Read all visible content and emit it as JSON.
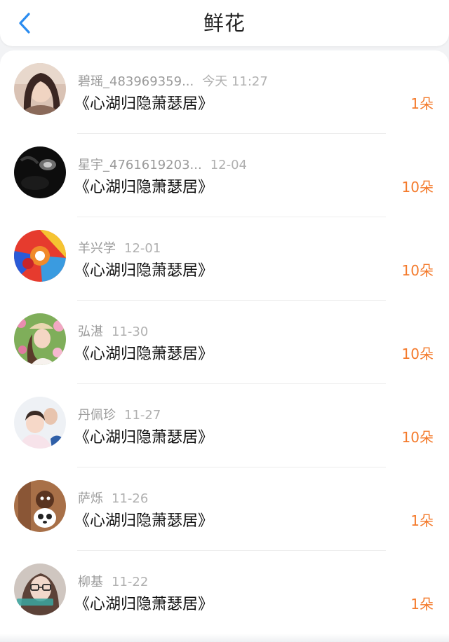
{
  "header": {
    "title": "鲜花",
    "back_icon": "chevron-left-icon",
    "accent_color": "#2b8cf0"
  },
  "list": {
    "count_color": "#f47a2b",
    "items": [
      {
        "name": "碧瑶_483969359...",
        "time": "今天 11:27",
        "book": "《心湖归隐萧瑟居》",
        "count": "1朵",
        "avatar": "avatar-woman-photo"
      },
      {
        "name": "星宇_4761619203...",
        "time": "12-04",
        "book": "《心湖归隐萧瑟居》",
        "count": "10朵",
        "avatar": "avatar-dark-photo"
      },
      {
        "name": "羊兴学",
        "time": "12-01",
        "book": "《心湖归隐萧瑟居》",
        "count": "10朵",
        "avatar": "avatar-colorful-swirl"
      },
      {
        "name": "弘湛",
        "time": "11-30",
        "book": "《心湖归隐萧瑟居》",
        "count": "10朵",
        "avatar": "avatar-woman-flowers"
      },
      {
        "name": "丹佩珍",
        "time": "11-27",
        "book": "《心湖归隐萧瑟居》",
        "count": "10朵",
        "avatar": "avatar-child-photo"
      },
      {
        "name": "萨烁",
        "time": "11-26",
        "book": "《心湖归隐萧瑟居》",
        "count": "1朵",
        "avatar": "avatar-cartoon-bear"
      },
      {
        "name": "柳基",
        "time": "11-22",
        "book": "《心湖归隐萧瑟居》",
        "count": "1朵",
        "avatar": "avatar-woman-glasses"
      }
    ]
  }
}
